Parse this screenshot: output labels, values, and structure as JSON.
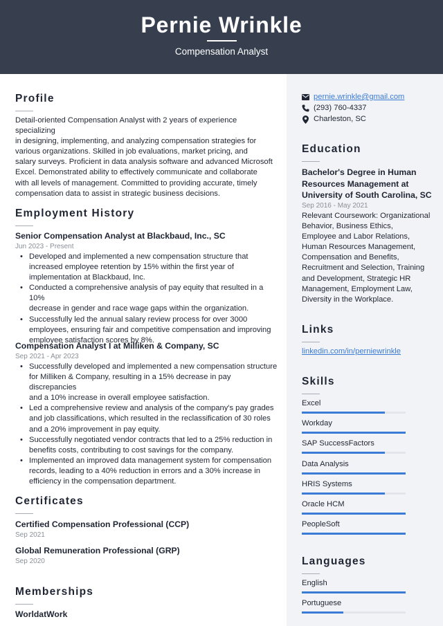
{
  "header": {
    "name": "Pernie Wrinkle",
    "title": "Compensation Analyst"
  },
  "colors": {
    "header_bg": "#373f4f",
    "sidebar_bg": "#f2f3f6",
    "accent": "#3a7bd5"
  },
  "profile": {
    "heading": "Profile",
    "lines": [
      "Detail-oriented Compensation Analyst with 2 years of experience specializing",
      "in designing, implementing, and analyzing compensation strategies for",
      "various organizations. Skilled in job evaluations, market pricing, and",
      "salary surveys. Proficient in data analysis software and advanced Microsoft",
      "Excel. Demonstrated ability to effectively communicate and collaborate",
      "with all levels of management. Committed to providing accurate, timely",
      "compensation data to assist in strategic business decisions."
    ]
  },
  "employment": {
    "heading": "Employment History",
    "jobs": [
      {
        "title": "Senior Compensation Analyst at Blackbaud, Inc., SC",
        "dates": "Jun 2023 - Present",
        "bullets": [
          [
            "Developed and implemented a new compensation structure that",
            "increased employee retention by 15% within the first year of",
            "implementation at Blackbaud, Inc."
          ],
          [
            "Conducted a comprehensive analysis of pay equity that resulted in a 10%",
            "decrease in gender and race wage gaps within the organization."
          ],
          [
            "Successfully led the annual salary review process for over 3000",
            "employees, ensuring fair and competitive compensation and improving",
            "employee satisfaction scores by 8%."
          ]
        ]
      },
      {
        "title": "Compensation Analyst I at Milliken & Company, SC",
        "dates": "Sep 2021 - Apr 2023",
        "bullets": [
          [
            "Successfully developed and implemented a new compensation structure",
            "for Milliken & Company, resulting in a 15% decrease in pay discrepancies",
            "and a 10% increase in overall employee satisfaction."
          ],
          [
            "Led a comprehensive review and analysis of the company's pay grades",
            "and job classifications, which resulted in the reclassification of 30 roles",
            "and a 20% improvement in pay equity."
          ],
          [
            "Successfully negotiated vendor contracts that led to a 25% reduction in",
            "benefits costs, contributing to cost savings for the company."
          ],
          [
            "Implemented an improved data management system for compensation",
            "records, leading to a 40% reduction in errors and a 30% increase in",
            "efficiency in the compensation department."
          ]
        ]
      }
    ]
  },
  "certificates": {
    "heading": "Certificates",
    "items": [
      {
        "name": "Certified Compensation Professional (CCP)",
        "date": "Sep 2021"
      },
      {
        "name": "Global Remuneration Professional (GRP)",
        "date": "Sep 2020"
      }
    ]
  },
  "memberships": {
    "heading": "Memberships",
    "items": [
      "WorldatWork"
    ]
  },
  "contact": {
    "email": "pernie.wrinkle@gmail.com",
    "phone": "(293) 760-4337",
    "location": "Charleston, SC",
    "icons": [
      "envelope-icon",
      "phone-icon",
      "map-pin-icon"
    ]
  },
  "education": {
    "heading": "Education",
    "degree_lines": [
      "Bachelor's Degree in Human",
      "Resources Management at",
      "University of South Carolina, SC"
    ],
    "dates": "Sep 2016 - May 2021",
    "coursework_lines": [
      "Relevant Coursework: Organizational",
      "Behavior, Business Ethics,",
      "Employee and Labor Relations,",
      "Human Resources Management,",
      "Compensation and Benefits,",
      "Recruitment and Selection, Training",
      "and Development, Strategic HR",
      "Management, Employment Law,",
      "Diversity in the Workplace."
    ]
  },
  "links": {
    "heading": "Links",
    "items": [
      "linkedin.com/in/perniewrinkle"
    ]
  },
  "skills": {
    "heading": "Skills",
    "items": [
      {
        "name": "Excel",
        "level": 0.8
      },
      {
        "name": "Workday",
        "level": 1.0
      },
      {
        "name": "SAP SuccessFactors",
        "level": 0.8
      },
      {
        "name": "Data Analysis",
        "level": 1.0
      },
      {
        "name": "HRIS Systems",
        "level": 0.8
      },
      {
        "name": "Oracle HCM",
        "level": 1.0
      },
      {
        "name": "PeopleSoft",
        "level": 1.0
      }
    ]
  },
  "languages": {
    "heading": "Languages",
    "items": [
      {
        "name": "English",
        "level": 1.0
      },
      {
        "name": "Portuguese",
        "level": 0.4
      }
    ]
  }
}
